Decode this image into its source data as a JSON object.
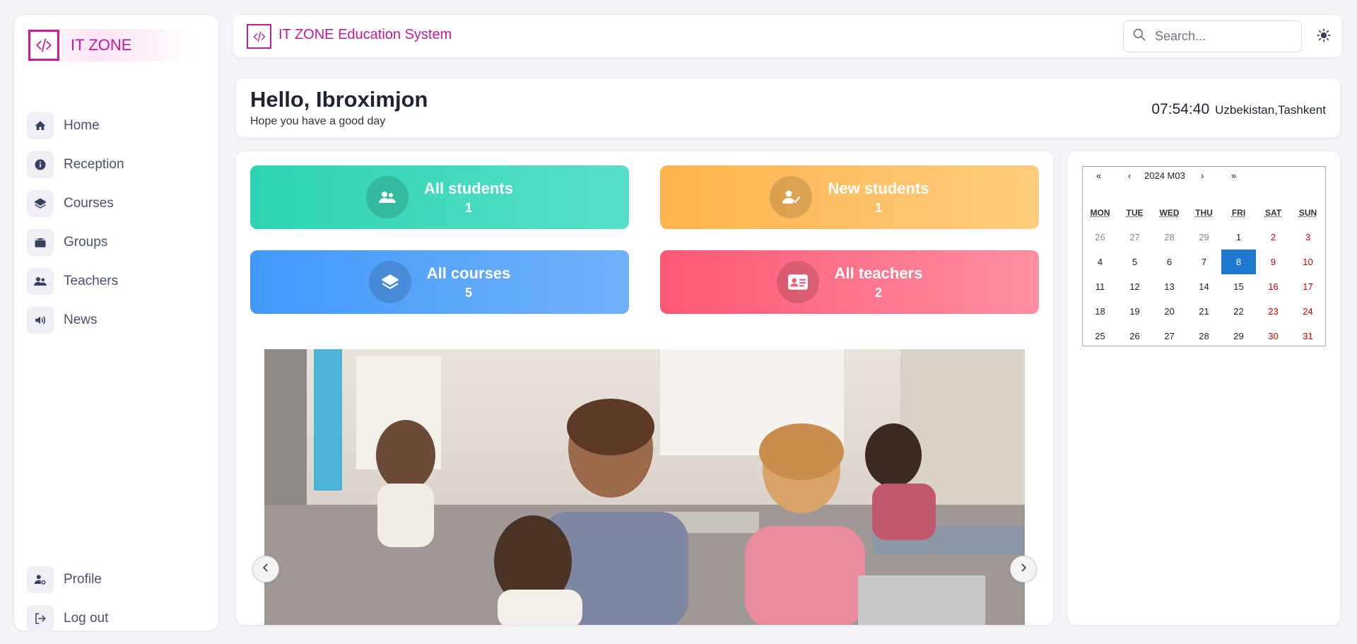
{
  "brand": {
    "name": "IT ZONE",
    "accent": "#c41b9e"
  },
  "sidebar": {
    "items": [
      {
        "label": "Home",
        "icon": "home-icon"
      },
      {
        "label": "Reception",
        "icon": "info-icon"
      },
      {
        "label": "Courses",
        "icon": "layers-icon"
      },
      {
        "label": "Groups",
        "icon": "briefcase-icon"
      },
      {
        "label": "Teachers",
        "icon": "users-icon"
      },
      {
        "label": "News",
        "icon": "speaker-icon"
      }
    ],
    "bottom": [
      {
        "label": "Profile",
        "icon": "user-gear-icon"
      },
      {
        "label": "Log out",
        "icon": "logout-icon"
      }
    ]
  },
  "topbar": {
    "title": "IT ZONE Education System",
    "search_placeholder": "Search...",
    "theme_icon": "sun-icon"
  },
  "greeting": {
    "title": "Hello, Ibroximjon",
    "subtitle": "Hope you have a good day",
    "time": "07:54:40",
    "location": "Uzbekistan,Tashkent"
  },
  "stats": [
    {
      "label": "All students",
      "value": "1",
      "icon": "users-icon",
      "color": "#2ed4b0"
    },
    {
      "label": "New students",
      "value": "1",
      "icon": "user-check-icon",
      "color": "#ffb44d"
    },
    {
      "label": "All courses",
      "value": "5",
      "icon": "layers-icon",
      "color": "#4299fb"
    },
    {
      "label": "All teachers",
      "value": "2",
      "icon": "id-card-icon",
      "color": "#fe5874"
    }
  ],
  "carousel": {
    "image": "classroom-photo",
    "prev_icon": "chevron-left-icon",
    "next_icon": "chevron-right-icon"
  },
  "calendar": {
    "nav": {
      "prev_year": "«",
      "prev_month": "‹",
      "label": "2024 M03",
      "next_month": "›",
      "next_year": "»"
    },
    "weekdays": [
      "MON",
      "TUE",
      "WED",
      "THU",
      "FRI",
      "SAT",
      "SUN"
    ],
    "weeks": [
      [
        "26",
        "27",
        "28",
        "29",
        "1",
        "2",
        "3"
      ],
      [
        "4",
        "5",
        "6",
        "7",
        "8",
        "9",
        "10"
      ],
      [
        "11",
        "12",
        "13",
        "14",
        "15",
        "16",
        "17"
      ],
      [
        "18",
        "19",
        "20",
        "21",
        "22",
        "23",
        "24"
      ],
      [
        "25",
        "26",
        "27",
        "28",
        "29",
        "30",
        "31"
      ]
    ],
    "selected": "8",
    "today_color": "#1f77cf",
    "weekend_color": "#d10000"
  }
}
